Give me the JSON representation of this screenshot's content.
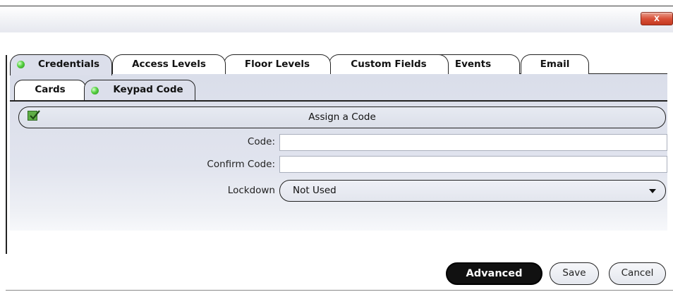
{
  "window": {
    "close_label": "x"
  },
  "tabs": [
    {
      "label": "Credentials",
      "active": true,
      "status": "green"
    },
    {
      "label": "Access Levels"
    },
    {
      "label": "Floor Levels"
    },
    {
      "label": "Custom Fields"
    },
    {
      "label": "Events"
    },
    {
      "label": "Email"
    }
  ],
  "sub_tabs": [
    {
      "label": "Cards"
    },
    {
      "label": "Keypad Code",
      "active": true,
      "status": "green"
    }
  ],
  "assign_code": {
    "label": "Assign a Code",
    "checked": true
  },
  "form": {
    "code_label": "Code:",
    "code_value": "",
    "confirm_label": "Confirm Code:",
    "confirm_value": "",
    "lockdown_label": "Lockdown",
    "lockdown_value": "Not Used"
  },
  "buttons": {
    "advanced": "Advanced",
    "save": "Save",
    "cancel": "Cancel"
  },
  "colors": {
    "panel": "#dcdfeb",
    "status_green": "#55d040",
    "close_red": "#d9523a"
  }
}
